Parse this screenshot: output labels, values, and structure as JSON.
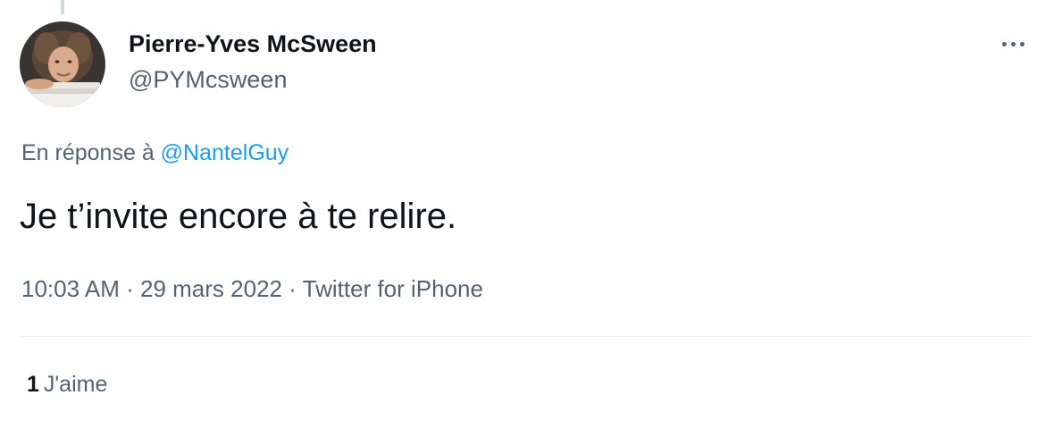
{
  "tweet": {
    "author": {
      "display_name": "Pierre-Yves McSween",
      "handle": "@PYMcsween"
    },
    "reply_prefix": "En réponse à",
    "reply_to": "@NantelGuy",
    "text": "Je t’invite encore à te relire.",
    "time": "10:03 AM",
    "date": "29 mars 2022",
    "source": "Twitter for iPhone",
    "separator": "·",
    "likes": {
      "count": "1",
      "label": "J'aime"
    },
    "more_icon": "more-horizontal-icon"
  }
}
